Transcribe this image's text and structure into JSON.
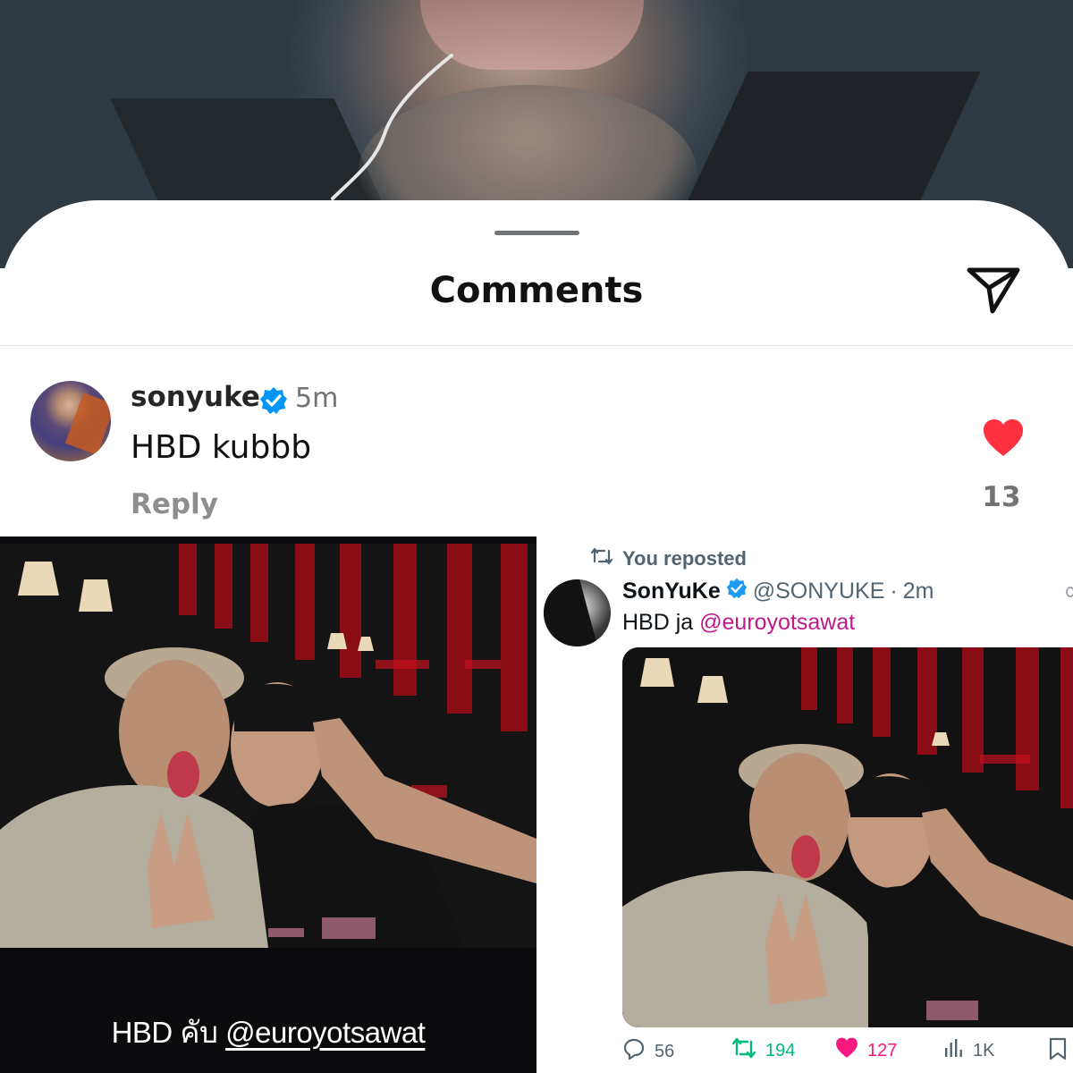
{
  "comments_sheet": {
    "title": "Comments",
    "icons": {
      "share": "send-icon",
      "verified": "verified-badge-icon",
      "like": "heart-filled-icon"
    },
    "comment": {
      "username": "sonyuke",
      "time": "5m",
      "text": "HBD kubbb",
      "reply_label": "Reply",
      "like_count": "13"
    }
  },
  "story": {
    "caption_prefix": "HBD คับ",
    "caption_mention": "@euroyotsawat"
  },
  "tweet": {
    "repost_label": "You reposted",
    "display_name": "SonYuKe",
    "handle": "@SONYUKE",
    "separator": "·",
    "time": "2m",
    "text_prefix": "HBD ja",
    "text_mention": "@euroyotsawat",
    "actions": {
      "replies": "56",
      "reposts": "194",
      "likes": "127",
      "views": "1K"
    }
  },
  "colors": {
    "like_red": "#ff3040",
    "verified_blue": "#0095f6",
    "repost_green": "#00ba7c",
    "like_pink": "#f91880",
    "mention_pink": "#c2188b"
  }
}
